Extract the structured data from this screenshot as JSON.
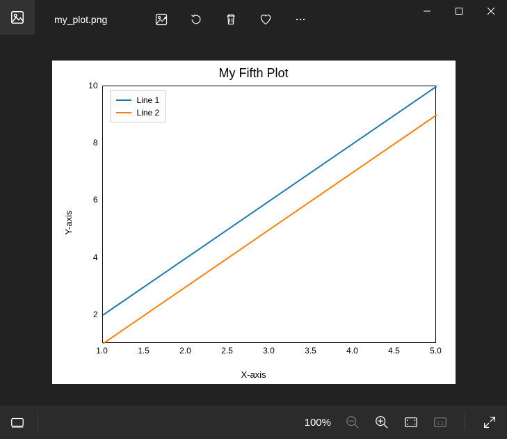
{
  "title": "my_plot.png",
  "status": {
    "zoom": "100%"
  },
  "chart_data": {
    "type": "line",
    "title": "My Fifth Plot",
    "xlabel": "X-axis",
    "ylabel": "Y-axis",
    "xticks": [
      "1.0",
      "1.5",
      "2.0",
      "2.5",
      "3.0",
      "3.5",
      "4.0",
      "4.5",
      "5.0"
    ],
    "yticks": [
      "2",
      "4",
      "6",
      "8",
      "10"
    ],
    "xlim": [
      1.0,
      5.0
    ],
    "ylim": [
      1.0,
      10.0
    ],
    "series": [
      {
        "name": "Line 1",
        "color": "#1f77b4",
        "x": [
          1,
          2,
          3,
          4,
          5
        ],
        "y": [
          2,
          4,
          6,
          8,
          10
        ]
      },
      {
        "name": "Line 2",
        "color": "#ff7f0e",
        "x": [
          1,
          2,
          3,
          4,
          5
        ],
        "y": [
          1,
          3,
          5,
          7,
          9
        ]
      }
    ]
  }
}
